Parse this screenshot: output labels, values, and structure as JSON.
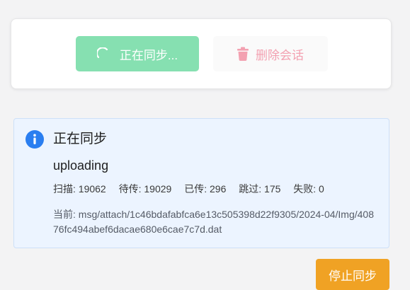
{
  "actions": {
    "sync_label": "正在同步...",
    "delete_label": "删除会话"
  },
  "status_panel": {
    "title": "正在同步",
    "phase": "uploading",
    "stats": {
      "scanned": "扫描: 19062",
      "pending": "待传: 19029",
      "uploaded": "已传: 296",
      "skipped": "跳过: 175",
      "failed": "失败: 0"
    },
    "current_file": "当前: msg/attach/1c46bdafabfca6e13c505398d22f9305/2024-04/Img/40876fc494abef6dacae680e6cae7c7d.dat"
  },
  "stop_button": {
    "label": "停止同步"
  },
  "colors": {
    "sync_button_bg": "#86e0b1",
    "delete_text": "#f3a1b1",
    "info_bg": "#ecf4ff",
    "info_icon": "#2a7ef0",
    "stop_button_bg": "#f0a224"
  },
  "icons": {
    "sync": "spinner-icon",
    "delete": "trash-icon",
    "info": "info-icon"
  }
}
